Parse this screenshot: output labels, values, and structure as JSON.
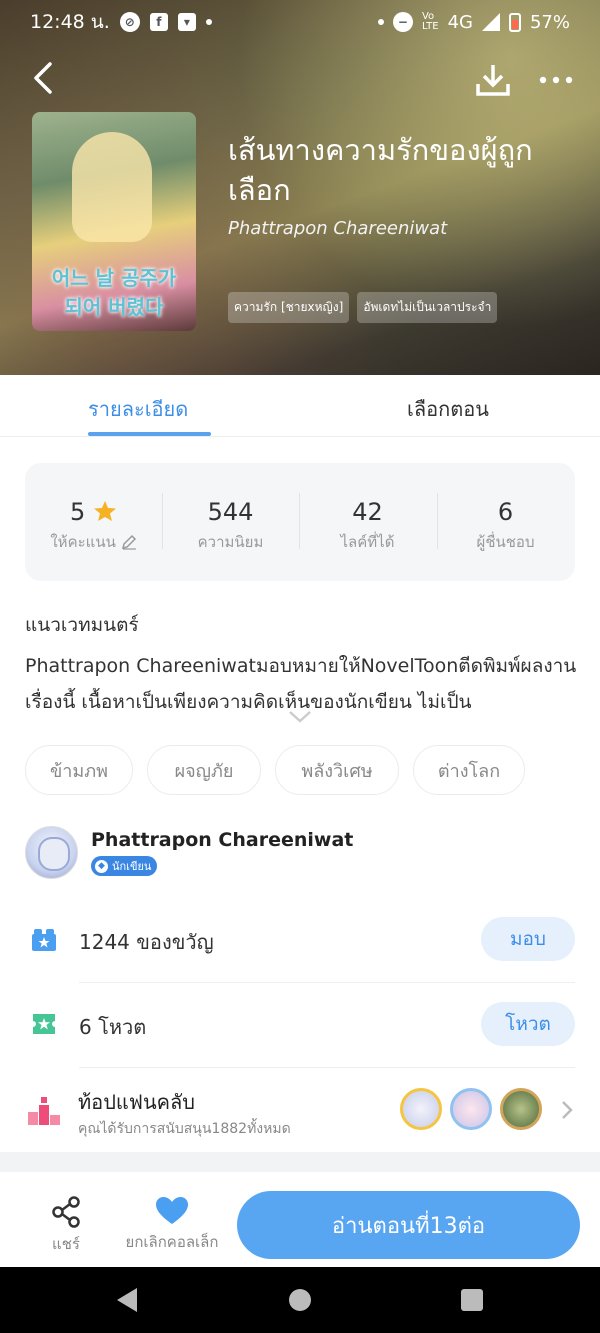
{
  "status": {
    "time": "12:48 น.",
    "network": "4G",
    "battery": "57%"
  },
  "book": {
    "title": "เส้นทางความรักของผู้ถูกเลือก",
    "author": "Phattrapon Chareeniwat",
    "cover_text": "어느 날 공주가 되어 버렸다",
    "tags": [
      "ความรัก [ชายxหญิง]",
      "อัพเดทไม่เป็นเวลาประจำ"
    ]
  },
  "tabs": {
    "details": "รายละเอียด",
    "episodes": "เลือกตอน"
  },
  "stats": [
    {
      "value": "5",
      "label": "ให้คะแนน"
    },
    {
      "value": "544",
      "label": "ความนิยม"
    },
    {
      "value": "42",
      "label": "ไลค์ที่ได้"
    },
    {
      "value": "6",
      "label": "ผู้ชื่นชอบ"
    }
  ],
  "description": {
    "genre_line": "แนวเวทมนตร์",
    "text": "Phattrapon Chareeniwatมอบหมายให้NovelToonตีดพิมพ์ผลงานเรื่องนี้ เนื้อหาเป็นเพียงความคิดเห็นของนักเขียน ไม่เป็น"
  },
  "genres": [
    "ข้ามภพ",
    "ผจญภัย",
    "พลังวิเศษ",
    "ต่างโลก"
  ],
  "writer": {
    "name": "Phattrapon Chareeniwat",
    "badge": "นักเขียน"
  },
  "gifts": {
    "text": "1244 ของขวัญ",
    "button": "มอบ"
  },
  "votes": {
    "text": "6 โหวต",
    "button": "โหวต"
  },
  "fanclub": {
    "title": "ท้อปแฟนคลับ",
    "subtitle": "คุณได้รับการสนับสนุน1882ทั้งหมด"
  },
  "bottom": {
    "share": "แชร์",
    "uncollect": "ยกเลิกคอลเล็ก",
    "read": "อ่านตอนที่13ต่อ"
  },
  "colors": {
    "accent": "#3d8ee8",
    "button": "#58a6f2",
    "star": "#f5b324"
  }
}
